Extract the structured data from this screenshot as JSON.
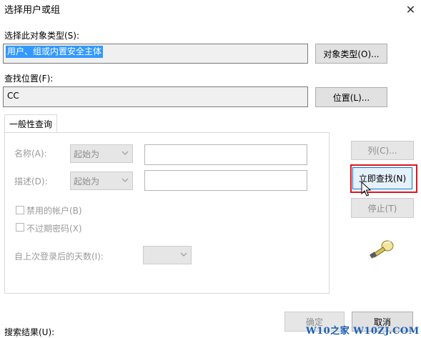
{
  "window": {
    "title": "选择用户或组",
    "close_glyph": "✕"
  },
  "object_type": {
    "label": "选择此对象类型(S):",
    "value": "用户、组或内置安全主体",
    "button": "对象类型(O)..."
  },
  "location": {
    "label": "查找位置(F):",
    "value": "CC",
    "button": "位置(L)..."
  },
  "tabs": [
    {
      "label": "一般性查询",
      "selected": true
    }
  ],
  "query": {
    "name_label": "名称(A):",
    "name_mode": "起始为",
    "desc_label": "描述(D):",
    "desc_mode": "起始为",
    "disabled_accounts": "禁用的帐户(B)",
    "non_expiring": "不过期密码(X)",
    "days_label": "自上次登录后的天数(I):"
  },
  "side_buttons": {
    "columns": "列(C)...",
    "find_now": "立即查找(N)",
    "stop": "停止(T)"
  },
  "footer": {
    "ok": "确定",
    "cancel": "取消",
    "results_label": "搜索结果(U):"
  },
  "watermark": "W10之家 W10ZJ.COM",
  "colors": {
    "highlight": "#3399ff",
    "annotation_box": "#e0141e",
    "watermark": "#1a5fb4"
  },
  "icons": [
    "close-icon",
    "dropdown-arrow-icon",
    "search-flashlight-icon",
    "mouse-cursor-icon"
  ]
}
